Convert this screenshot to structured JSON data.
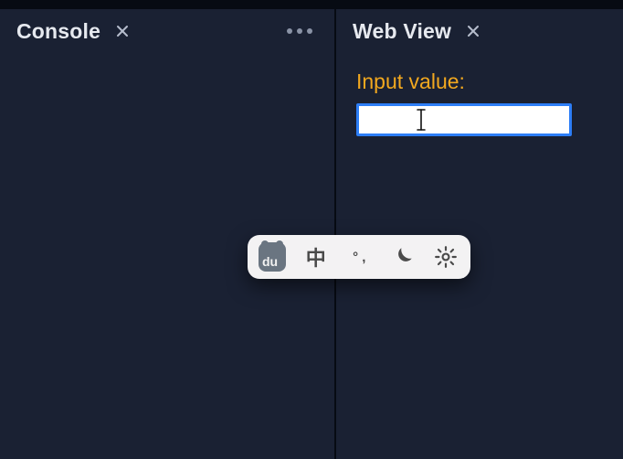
{
  "tabs": {
    "console": {
      "title": "Console"
    },
    "webview": {
      "title": "Web View"
    }
  },
  "webview": {
    "field_label": "Input value:",
    "input_value": "",
    "input_placeholder": ""
  },
  "ime": {
    "items": [
      {
        "id": "du-badge",
        "label": "du"
      },
      {
        "id": "lang-zh",
        "label": "中"
      },
      {
        "id": "punctuation",
        "label": "°,"
      },
      {
        "id": "dark-mode",
        "label": "moon"
      },
      {
        "id": "settings",
        "label": "gear"
      }
    ]
  }
}
